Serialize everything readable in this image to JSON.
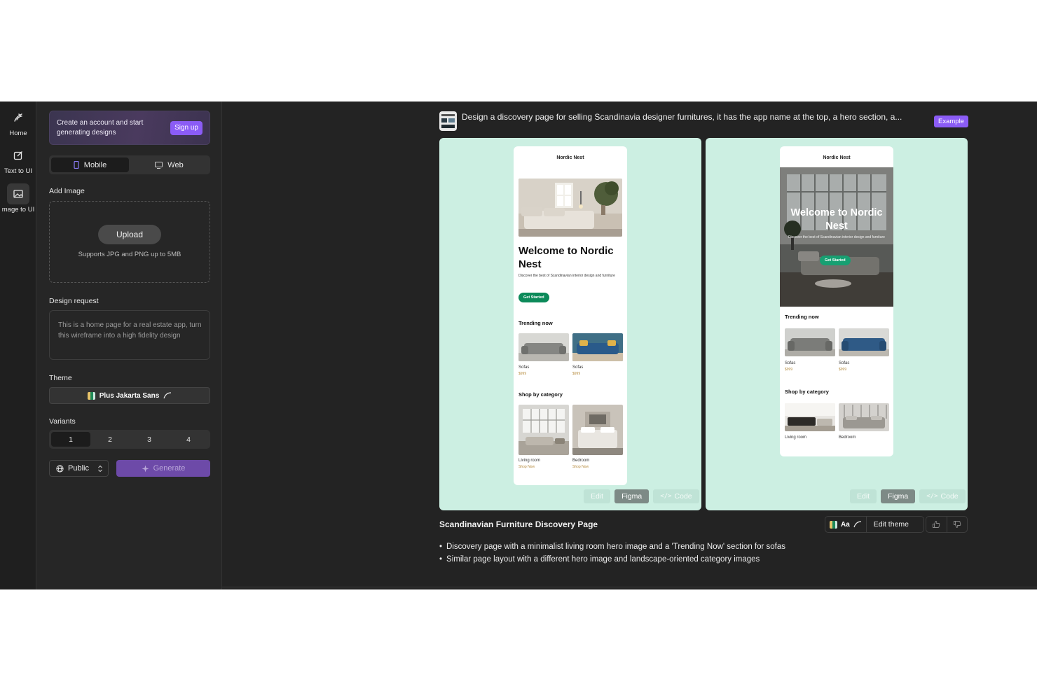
{
  "rail": {
    "items": [
      {
        "label": "Home",
        "icon": "home-icon"
      },
      {
        "label": "Text to UI",
        "icon": "edit-icon"
      },
      {
        "label": "mage to UI",
        "icon": "image-icon"
      }
    ]
  },
  "promo": {
    "text": "Create an account and start generating designs",
    "button": "Sign up"
  },
  "platform": {
    "options": [
      "Mobile",
      "Web"
    ],
    "selected": "Mobile"
  },
  "add_image": {
    "label": "Add Image",
    "upload_button": "Upload",
    "hint": "Supports JPG and PNG up to 5MB"
  },
  "design_request": {
    "label": "Design request",
    "placeholder": "This is a home page for a real estate app, turn this wireframe into a high fidelity design"
  },
  "theme": {
    "label": "Theme",
    "font_name": "Plus Jakarta Sans"
  },
  "variants": {
    "label": "Variants",
    "options": [
      "1",
      "2",
      "3",
      "4"
    ],
    "selected": "1"
  },
  "visibility": {
    "value": "Public"
  },
  "generate": {
    "label": "Generate"
  },
  "prompt": {
    "text": "Design a discovery page for selling Scandinavia designer furnitures, it has the app name at the top, a hero section, a...",
    "badge": "Example"
  },
  "results": {
    "card_actions": {
      "edit": "Edit",
      "figma": "Figma",
      "code": "Code"
    },
    "variant1": {
      "app_name": "Nordic Nest",
      "hero_title": "Welcome to Nordic Nest",
      "hero_desc": "Discover the best of Scandinavian interior design and furniture",
      "cta": "Get Started",
      "trending_title": "Trending now",
      "trending": [
        {
          "label": "Sofas",
          "price": "$999"
        },
        {
          "label": "Sofas",
          "price": "$999"
        }
      ],
      "category_title": "Shop by category",
      "categories": [
        {
          "label": "Living room",
          "link": "Shop Now"
        },
        {
          "label": "Bedroom",
          "link": "Shop Now"
        }
      ]
    },
    "variant2": {
      "app_name": "Nordic Nest",
      "hero_title": "Welcome to Nordic Nest",
      "hero_desc": "Discover the best of Scandinavian interior design and furniture",
      "cta": "Get Started",
      "trending_title": "Trending now",
      "trending": [
        {
          "label": "Sofas",
          "price": "$999"
        },
        {
          "label": "Sofas",
          "price": "$999"
        }
      ],
      "category_title": "Shop by category",
      "categories": [
        {
          "label": "Living room"
        },
        {
          "label": "Bedroom"
        }
      ]
    },
    "title": "Scandinavian Furniture Discovery Page",
    "theme_pill": {
      "font_abbrev": "Aa",
      "edit_label": "Edit theme"
    },
    "bullets": [
      "Discovery page with a minimalist living room hero image and a 'Trending Now' section for sofas",
      "Similar page layout with a different hero image and landscape-oriented category images"
    ]
  },
  "colors": {
    "accent": "#8b5cf6",
    "background": "#232323",
    "card": "#ccefe2",
    "cta": "#0c8a5a"
  }
}
